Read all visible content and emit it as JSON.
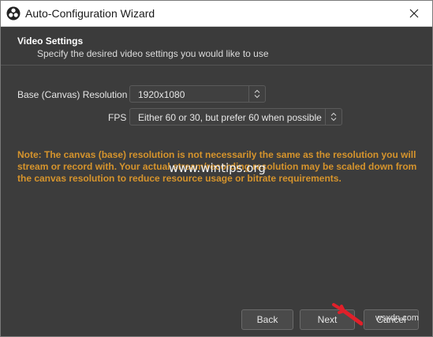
{
  "window": {
    "title": "Auto-Configuration Wizard",
    "close_icon": "close-icon",
    "app_icon": "obs-logo-icon"
  },
  "section": {
    "title": "Video Settings",
    "subtitle": "Specify the desired video settings you would like to use"
  },
  "fields": {
    "resolution": {
      "label": "Base (Canvas) Resolution",
      "value": "1920x1080"
    },
    "fps": {
      "label": "FPS",
      "value": "Either 60 or 30, but prefer 60 when possible"
    }
  },
  "note": {
    "text": "Note: The canvas (base) resolution is not necessarily the same as the resolution you will stream or record with. Your actual stream/recording resolution may be scaled down from the canvas resolution to reduce resource usage or bitrate requirements."
  },
  "watermark": "www.wintips.org",
  "buttons": {
    "back": "Back",
    "next": "Next",
    "cancel": "Cancel"
  },
  "source_mark": "wsxdn.com",
  "colors": {
    "window_bg": "#3c3c3c",
    "note_text": "#d6942c",
    "arrow": "#e0202a"
  }
}
